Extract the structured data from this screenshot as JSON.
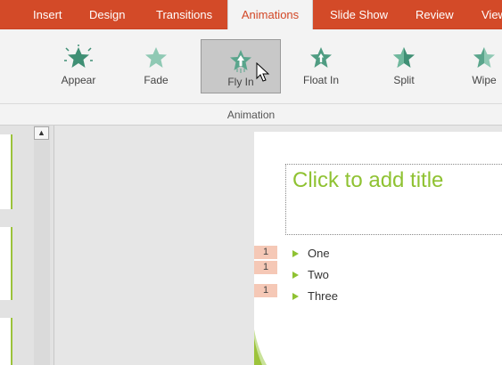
{
  "ribbon": {
    "tabs": [
      {
        "label": "Insert"
      },
      {
        "label": "Design"
      },
      {
        "label": "Transitions"
      },
      {
        "label": "Animations"
      },
      {
        "label": "Slide Show"
      },
      {
        "label": "Review"
      },
      {
        "label": "View"
      }
    ],
    "active_tab": "Animations",
    "gallery": [
      {
        "label": "Appear",
        "icon": "appear-star-icon"
      },
      {
        "label": "Fade",
        "icon": "fade-star-icon"
      },
      {
        "label": "Fly In",
        "icon": "fly-in-star-icon",
        "selected": true
      },
      {
        "label": "Float In",
        "icon": "float-in-star-icon"
      },
      {
        "label": "Split",
        "icon": "split-star-icon"
      },
      {
        "label": "Wipe",
        "icon": "wipe-star-icon"
      }
    ],
    "group_label": "Animation"
  },
  "slide": {
    "title_placeholder": "Click to add title",
    "bullets": [
      {
        "tag": "1",
        "text": "One"
      },
      {
        "tag": "1",
        "text": "Two"
      },
      {
        "tag": "1",
        "text": "Three"
      }
    ]
  },
  "colors": {
    "accent": "#d24726",
    "tab_bar": "#d34a28",
    "title_green": "#8fc232",
    "star_teal": "#5aa58c",
    "tag_peach": "#f5c8b6"
  }
}
